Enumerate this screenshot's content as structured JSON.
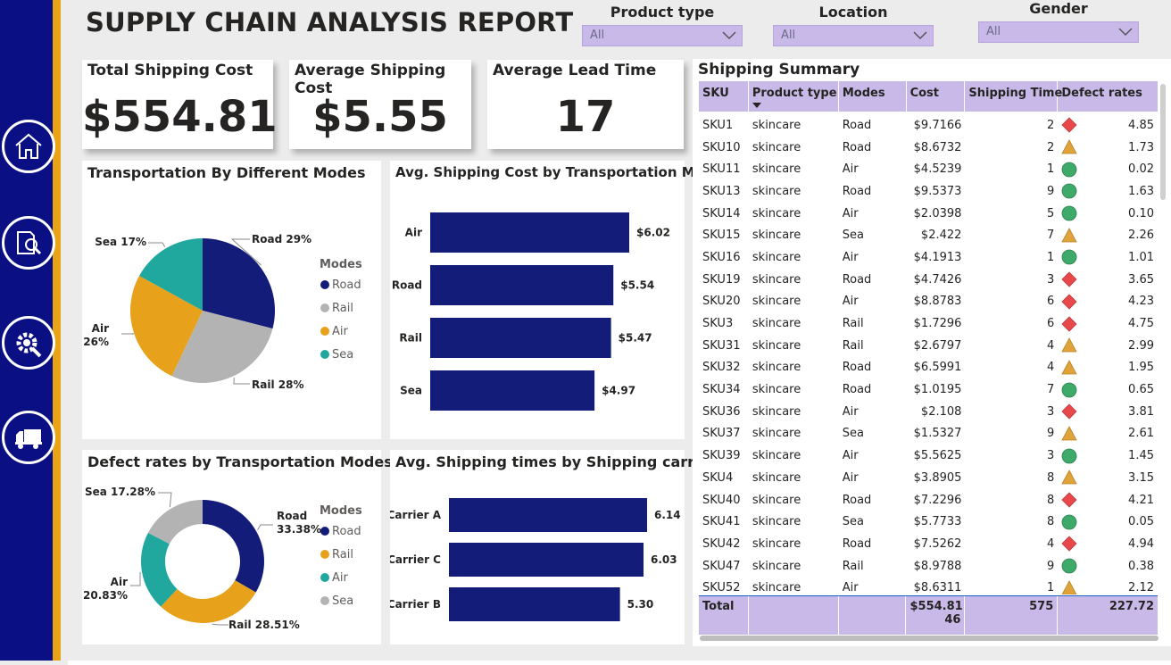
{
  "header": {
    "title": "SUPPLY CHAIN ANALYSIS REPORT"
  },
  "filters": [
    {
      "label": "Product type",
      "value": "All"
    },
    {
      "label": "Location",
      "value": "All"
    },
    {
      "label": "Gender",
      "value": "All"
    }
  ],
  "nav": [
    {
      "icon": "home-icon"
    },
    {
      "icon": "report-search-icon"
    },
    {
      "icon": "settings-wrench-icon"
    },
    {
      "icon": "truck-icon"
    }
  ],
  "kpis": [
    {
      "label": "Total Shipping Cost",
      "value": "$554.81"
    },
    {
      "label": "Average Shipping Cost",
      "value": "$5.55"
    },
    {
      "label": "Average Lead Time",
      "value": "17"
    }
  ],
  "colors": {
    "navy": "#141c7a",
    "grey": "#b3b3b3",
    "orange": "#e8a11b",
    "teal": "#20a89e",
    "purple": "#c9b9e8",
    "red": "#e8484a",
    "green": "#3eaa6a",
    "amber": "#e0a33b"
  },
  "chart_data": [
    {
      "type": "pie",
      "title": "Transportation By Different Modes",
      "legend_title": "Modes",
      "legend": [
        "Road",
        "Rail",
        "Air",
        "Sea"
      ],
      "slices": [
        {
          "name": "Road",
          "value": 29,
          "label": "Road 29%"
        },
        {
          "name": "Rail",
          "value": 28,
          "label": "Rail 28%"
        },
        {
          "name": "Air",
          "value": 26,
          "label": "Air 26%"
        },
        {
          "name": "Sea",
          "value": 17,
          "label": "Sea 17%"
        }
      ]
    },
    {
      "type": "bar",
      "title": "Avg. Shipping Cost by Transportation Modes",
      "categories": [
        "Air",
        "Road",
        "Rail",
        "Sea"
      ],
      "values": [
        6.02,
        5.54,
        5.47,
        4.97
      ],
      "labels": [
        "$6.02",
        "$5.54",
        "$5.47",
        "$4.97"
      ]
    },
    {
      "type": "pie",
      "title": "Defect rates by Transportation Modes",
      "legend_title": "Modes",
      "legend": [
        "Road",
        "Rail",
        "Air",
        "Sea"
      ],
      "slices": [
        {
          "name": "Road",
          "value": 33.38,
          "label": "Road 33.38%"
        },
        {
          "name": "Rail",
          "value": 28.51,
          "label": "Rail 28.51%"
        },
        {
          "name": "Air",
          "value": 20.83,
          "label": "Air 20.83%"
        },
        {
          "name": "Sea",
          "value": 17.28,
          "label": "Sea 17.28%"
        }
      ]
    },
    {
      "type": "bar",
      "title": "Avg. Shipping times by Shipping carriers",
      "categories": [
        "Carrier A",
        "Carrier C",
        "Carrier B"
      ],
      "values": [
        6.14,
        6.03,
        5.3
      ],
      "labels": [
        "6.14",
        "6.03",
        "5.30"
      ]
    },
    {
      "type": "table",
      "title": "Shipping Summary",
      "columns": [
        "SKU",
        "Product type",
        "Modes",
        "Cost",
        "Shipping Time",
        "Defect rates"
      ],
      "rows": [
        [
          "SKU1",
          "skincare",
          "Road",
          "$9.7166",
          2,
          "diamond",
          "4.85"
        ],
        [
          "SKU10",
          "skincare",
          "Road",
          "$8.6732",
          2,
          "triangle",
          "1.73"
        ],
        [
          "SKU11",
          "skincare",
          "Air",
          "$4.5239",
          1,
          "circle",
          "0.02"
        ],
        [
          "SKU13",
          "skincare",
          "Road",
          "$9.5373",
          9,
          "circle",
          "1.63"
        ],
        [
          "SKU14",
          "skincare",
          "Air",
          "$2.0398",
          5,
          "circle",
          "0.10"
        ],
        [
          "SKU15",
          "skincare",
          "Sea",
          "$2.422",
          7,
          "triangle",
          "2.26"
        ],
        [
          "SKU16",
          "skincare",
          "Air",
          "$4.1913",
          1,
          "circle",
          "1.01"
        ],
        [
          "SKU19",
          "skincare",
          "Road",
          "$4.7426",
          3,
          "diamond",
          "3.65"
        ],
        [
          "SKU20",
          "skincare",
          "Air",
          "$8.8783",
          6,
          "diamond",
          "4.23"
        ],
        [
          "SKU3",
          "skincare",
          "Rail",
          "$1.7296",
          6,
          "diamond",
          "4.75"
        ],
        [
          "SKU31",
          "skincare",
          "Rail",
          "$2.6797",
          4,
          "triangle",
          "2.99"
        ],
        [
          "SKU32",
          "skincare",
          "Road",
          "$6.5991",
          4,
          "triangle",
          "1.95"
        ],
        [
          "SKU34",
          "skincare",
          "Road",
          "$1.0195",
          7,
          "circle",
          "0.65"
        ],
        [
          "SKU36",
          "skincare",
          "Air",
          "$2.108",
          3,
          "diamond",
          "3.81"
        ],
        [
          "SKU37",
          "skincare",
          "Sea",
          "$1.5327",
          9,
          "triangle",
          "2.61"
        ],
        [
          "SKU39",
          "skincare",
          "Air",
          "$5.5625",
          3,
          "circle",
          "1.45"
        ],
        [
          "SKU4",
          "skincare",
          "Air",
          "$3.8905",
          8,
          "triangle",
          "3.15"
        ],
        [
          "SKU40",
          "skincare",
          "Road",
          "$7.2296",
          8,
          "diamond",
          "4.21"
        ],
        [
          "SKU41",
          "skincare",
          "Sea",
          "$5.7733",
          8,
          "circle",
          "0.05"
        ],
        [
          "SKU42",
          "skincare",
          "Road",
          "$7.5262",
          4,
          "diamond",
          "4.94"
        ],
        [
          "SKU47",
          "skincare",
          "Rail",
          "$8.9788",
          9,
          "circle",
          "0.38"
        ],
        [
          "SKU52",
          "skincare",
          "Air",
          "$8.6311",
          1,
          "triangle",
          "2.12"
        ]
      ],
      "totals": {
        "label": "Total",
        "cost": "$554.81",
        "cost_cont": "46",
        "shipping_time": "575",
        "defect_rates": "227.72"
      }
    }
  ]
}
